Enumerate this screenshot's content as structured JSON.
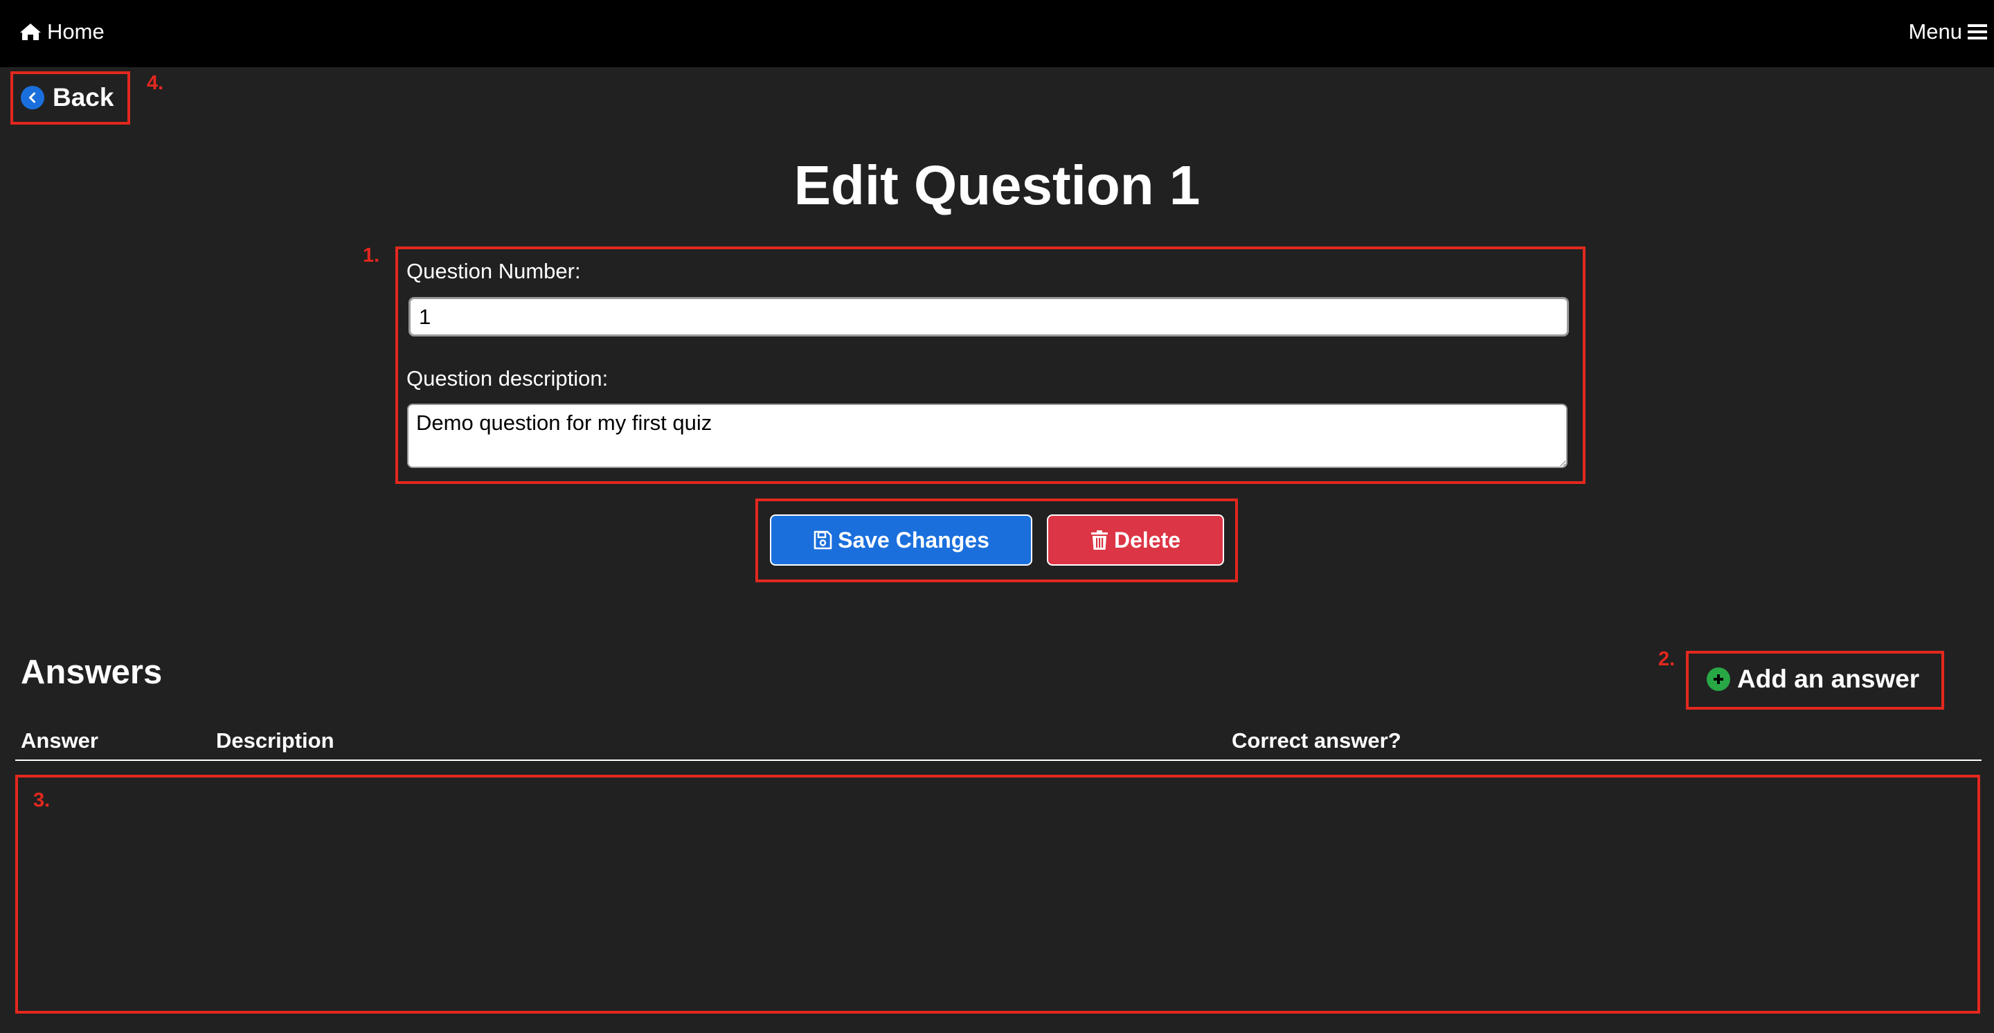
{
  "nav": {
    "home_label": "Home",
    "menu_label": "Menu"
  },
  "back_label": "Back",
  "page_title": "Edit Question 1",
  "form": {
    "number_label": "Question Number:",
    "number_value": "1",
    "description_label": "Question description:",
    "description_value": "Demo question for my first quiz"
  },
  "buttons": {
    "save_label": "Save Changes",
    "delete_label": "Delete"
  },
  "answers": {
    "heading": "Answers",
    "add_label": "Add an answer",
    "columns": [
      "Answer",
      "Description",
      "Correct answer?"
    ],
    "rows": []
  },
  "annotations": [
    "1.",
    "2.",
    "3.",
    "4."
  ],
  "colors": {
    "background": "#212121",
    "navbar": "#000000",
    "primary": "#1a6fdc",
    "danger": "#dc3545",
    "success": "#28a745",
    "annotation": "#e3281e"
  }
}
